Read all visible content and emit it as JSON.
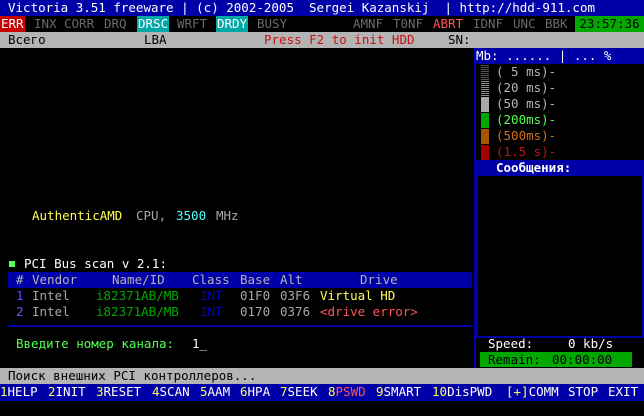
{
  "title_bar": {
    "text": "Victoria 3.51 freeware | (c) 2002-2005  Sergei Kazanskij  | http://hdd-911.com"
  },
  "flags": [
    {
      "label": "ERR",
      "state": "err"
    },
    {
      "label": "INX",
      "state": "off"
    },
    {
      "label": "CORR",
      "state": "off"
    },
    {
      "label": "DRQ",
      "state": "off"
    },
    {
      "label": "DRSC",
      "state": "on"
    },
    {
      "label": "WRFT",
      "state": "off"
    },
    {
      "label": "DRDY",
      "state": "on"
    },
    {
      "label": "BUSY",
      "state": "off"
    }
  ],
  "flags_right": [
    {
      "label": "AMNF",
      "state": "off"
    },
    {
      "label": "T0NF",
      "state": "off"
    },
    {
      "label": "ABRT",
      "state": "abrt"
    },
    {
      "label": "IDNF",
      "state": "off"
    },
    {
      "label": "UNC",
      "state": "off"
    },
    {
      "label": "BBK",
      "state": "off"
    }
  ],
  "clock": "23:57:36",
  "info_bar": {
    "total_label": "Всего",
    "lba_label": "LBA",
    "hint": "Press F2 to init HDD",
    "sn_label": "SN:"
  },
  "right_panel": {
    "header": "Mb: ...... | ... %",
    "legend": [
      {
        "label": "( 5 ms)-",
        "color": "#b4b4b4"
      },
      {
        "label": "(20 ms)-",
        "color": "#b4b4b4"
      },
      {
        "label": "(50 ms)-",
        "color": "#b4b4b4"
      },
      {
        "label": "(200ms)-",
        "color": "#55ff55"
      },
      {
        "label": "(500ms)-",
        "color": "#d07020"
      },
      {
        "label": "(1.5 s)-",
        "color": "#c81010"
      }
    ],
    "messages_title": "Сообщения:",
    "speed_label": "Speed:",
    "speed_value": "0 kb/s",
    "remain_label": "Remain:",
    "remain_value": "00:00:00"
  },
  "main": {
    "cpu_vendor": "AuthenticAMD",
    "cpu_label": "CPU,",
    "cpu_mhz": "3500",
    "mhz_unit": "MHz",
    "pci_title": "PCI Bus scan v 2.1:",
    "table_header": {
      "num": "#",
      "vendor": "Vendor",
      "name": "Name/ID",
      "class": "Class",
      "base": "Base",
      "alt": "Alt",
      "drive": "Drive"
    },
    "rows": [
      {
        "num": "1",
        "vendor": "Intel",
        "name": "i82371AB/MB",
        "class": "INT",
        "base": "01F0",
        "alt": "03F6",
        "drive": "Virtual HD"
      },
      {
        "num": "2",
        "vendor": "Intel",
        "name": "i82371AB/MB",
        "class": "INT",
        "base": "0170",
        "alt": "0376",
        "drive": "<drive error>"
      }
    ],
    "prompt_label": "Введите номер канала:",
    "prompt_value": "1_"
  },
  "status_line": "Поиск внешних PCI контроллеров...",
  "fkeys": [
    {
      "num": "1",
      "label": "HELP"
    },
    {
      "num": "2",
      "label": "INIT"
    },
    {
      "num": "3",
      "label": "RESET"
    },
    {
      "num": "4",
      "label": "SCAN"
    },
    {
      "num": "5",
      "label": "AAM"
    },
    {
      "num": "6",
      "label": "HPA"
    },
    {
      "num": "7",
      "label": "SEEK"
    },
    {
      "num": "8",
      "label": "PSWD"
    },
    {
      "num": "9",
      "label": "SMART"
    },
    {
      "num": "10",
      "label": "DisPWD"
    },
    {
      "num": "[+]",
      "label": "COMM"
    },
    {
      "num": "",
      "label": "STOP"
    },
    {
      "num": "",
      "label": "EXIT"
    }
  ]
}
